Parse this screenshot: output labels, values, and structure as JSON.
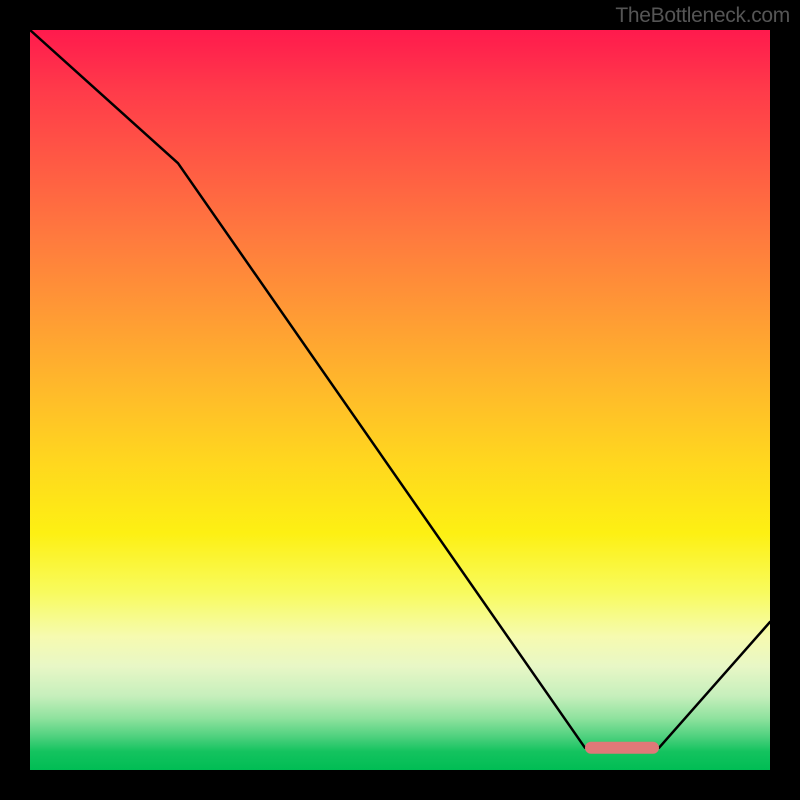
{
  "watermark": "TheBottleneck.com",
  "chart_data": {
    "type": "line",
    "title": "",
    "xlabel": "",
    "ylabel": "",
    "xlim": [
      0,
      100
    ],
    "ylim": [
      0,
      100
    ],
    "series": [
      {
        "name": "curve",
        "x": [
          0,
          20,
          75,
          85,
          100
        ],
        "values": [
          100,
          82,
          3,
          3,
          20
        ]
      }
    ],
    "gradient_stops": [
      {
        "pos": 0.0,
        "color": "#ff1a4d"
      },
      {
        "pos": 0.5,
        "color": "#ffc020"
      },
      {
        "pos": 0.78,
        "color": "#f8fb80"
      },
      {
        "pos": 1.0,
        "color": "#00bd54"
      }
    ],
    "marker": {
      "x_start": 75,
      "x_end": 85,
      "y": 3,
      "color": "#e07878"
    }
  }
}
